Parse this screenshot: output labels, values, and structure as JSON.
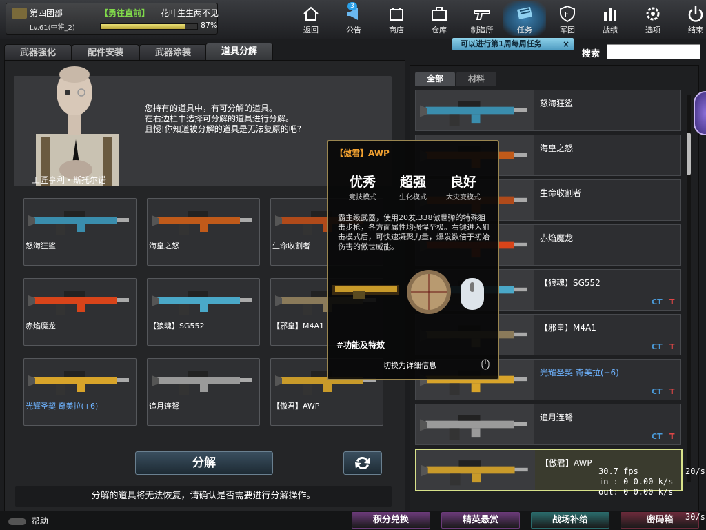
{
  "player": {
    "unit": "第四团部",
    "squad": "【勇往直前】",
    "name": "花叶生生两不见",
    "level": "Lv.61(中将_2)",
    "xp_percent": 87,
    "xp_label": "87%"
  },
  "nav": [
    {
      "label": "返回",
      "icon": "house-icon"
    },
    {
      "label": "公告",
      "icon": "megaphone-icon",
      "badge": "3"
    },
    {
      "label": "商店",
      "icon": "shop-icon"
    },
    {
      "label": "仓库",
      "icon": "briefcase-icon"
    },
    {
      "label": "制造所",
      "icon": "gun-icon"
    },
    {
      "label": "任务",
      "icon": "mission-icon",
      "active": true
    },
    {
      "label": "军团",
      "icon": "shield-icon"
    },
    {
      "label": "战绩",
      "icon": "bar-chart-icon"
    },
    {
      "label": "选项",
      "icon": "gear-icon"
    },
    {
      "label": "结束",
      "icon": "power-icon"
    }
  ],
  "quest_banner": "可以进行第1周每周任务",
  "quest_close": "×",
  "search_label": "搜索",
  "tabs": [
    "武器强化",
    "配件安装",
    "武器涂装",
    "道具分解"
  ],
  "npc": {
    "name": "工匠亨利・斯托尔诺",
    "lines": [
      "您持有的道具中，有可分解的道具。",
      "在右边栏中选择可分解的道具进行分解。",
      "且慢!你知道被分解的道具是无法复原的吧?"
    ]
  },
  "slots": [
    {
      "name": "怒海狂鲨",
      "color": "#3a8dad",
      "blue": false
    },
    {
      "name": "海皇之怒",
      "color": "#c05a1a",
      "blue": false
    },
    {
      "name": "生命收割者",
      "color": "#b04a1a",
      "blue": false
    },
    {
      "name": "赤焰魔龙",
      "color": "#d8441a",
      "blue": false
    },
    {
      "name": "【狼魂】SG552",
      "color": "#4aa8c8",
      "blue": false
    },
    {
      "name": "【邪皇】M4A1",
      "color": "#8a7a5a",
      "blue": false
    },
    {
      "name": "光耀圣契 奇美拉(+6)",
      "color": "#d8a42a",
      "blue": true
    },
    {
      "name": "追月连弩",
      "color": "#9a9a9a",
      "blue": false
    },
    {
      "name": "【傲君】AWP",
      "color": "#c89a2a",
      "blue": false
    }
  ],
  "decompose_button": "分解",
  "warning": "分解的道具将无法恢复，请确认是否需要进行分解操作。",
  "right_tabs": [
    "全部",
    "材料"
  ],
  "list": [
    {
      "name": "怒海狂鲨",
      "blue": false,
      "ct": "",
      "t": ""
    },
    {
      "name": "海皇之怒",
      "blue": false,
      "ct": "",
      "t": ""
    },
    {
      "name": "生命收割者",
      "blue": false,
      "ct": "",
      "t": ""
    },
    {
      "name": "赤焰魔龙",
      "blue": false,
      "ct": "",
      "t": ""
    },
    {
      "name": "【狼魂】SG552",
      "blue": false,
      "ct": "CT",
      "t": "T"
    },
    {
      "name": "【邪皇】M4A1",
      "blue": false,
      "ct": "CT",
      "t": "T"
    },
    {
      "name": "光耀圣契 奇美拉(+6)",
      "blue": true,
      "ct": "CT",
      "t": "T"
    },
    {
      "name": "追月连弩",
      "blue": false,
      "ct": "CT",
      "t": "T"
    },
    {
      "name": "【傲君】AWP",
      "blue": false,
      "ct": "",
      "t": "",
      "selected": true
    }
  ],
  "tooltip": {
    "title": "【傲君】AWP",
    "stats": [
      {
        "big": "优秀",
        "small": "竞技模式"
      },
      {
        "big": "超强",
        "small": "生化模式"
      },
      {
        "big": "良好",
        "small": "大灾变模式"
      }
    ],
    "desc": "霸主级武器，使用20发.338傲世弹的特殊狙击步枪，各方面属性均强悍至极。右键进入狙击模式后，可快速凝聚力量，爆发数倍于初始伤害的傲世威能。",
    "features": "#功能及特效",
    "switch": "切换为详细信息"
  },
  "footer": {
    "help": "帮助",
    "buttons": [
      {
        "label": "积分兑换",
        "color": "#6a3a78"
      },
      {
        "label": "精英悬赏",
        "color": "#6a3a78"
      },
      {
        "label": "战场补给",
        "color": "#2a6a6a"
      },
      {
        "label": "密码箱",
        "color": "#6a2a3a"
      }
    ]
  },
  "debug": {
    "fps": "30.7 fps",
    "in": "in : 0 0.00 k/s",
    "out": "out: 0 0.00 k/s",
    "fps_right": "20/s",
    "fps_bottom": "30/s"
  }
}
